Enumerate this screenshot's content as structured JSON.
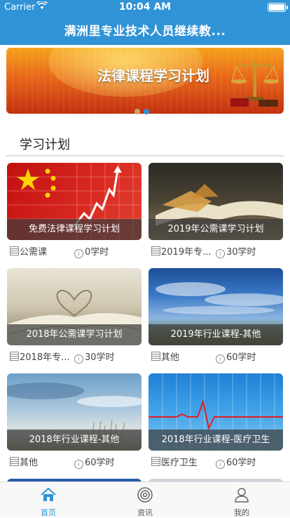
{
  "status": {
    "carrier": "Carrier",
    "time": "10:04 AM"
  },
  "header": {
    "title": "满洲里专业技术人员继续教..."
  },
  "banner": {
    "text": "法律课程学习计划",
    "active_index": 1
  },
  "section": {
    "title": "学习计划"
  },
  "cards": [
    {
      "title": "免费法律课程学习计划",
      "category": "公需课",
      "hours": "0学时"
    },
    {
      "title": "2019年公需课学习计划",
      "category": "2019年专...",
      "hours": "30学时"
    },
    {
      "title": "2018年公需课学习计划",
      "category": "2018年专...",
      "hours": "30学时"
    },
    {
      "title": "2019年行业课程-其他",
      "category": "其他",
      "hours": "60学时"
    },
    {
      "title": "2018年行业课程-其他",
      "category": "其他",
      "hours": "60学时"
    },
    {
      "title": "2018年行业课程-医疗卫生",
      "category": "医疗卫生",
      "hours": "60学时"
    }
  ],
  "tabs": [
    {
      "label": "首页",
      "icon": "home-icon",
      "active": true
    },
    {
      "label": "资讯",
      "icon": "news-icon",
      "active": false
    },
    {
      "label": "我的",
      "icon": "user-icon",
      "active": false
    }
  ],
  "colors": {
    "primary": "#2f93d6",
    "tab_inactive": "#555555"
  }
}
